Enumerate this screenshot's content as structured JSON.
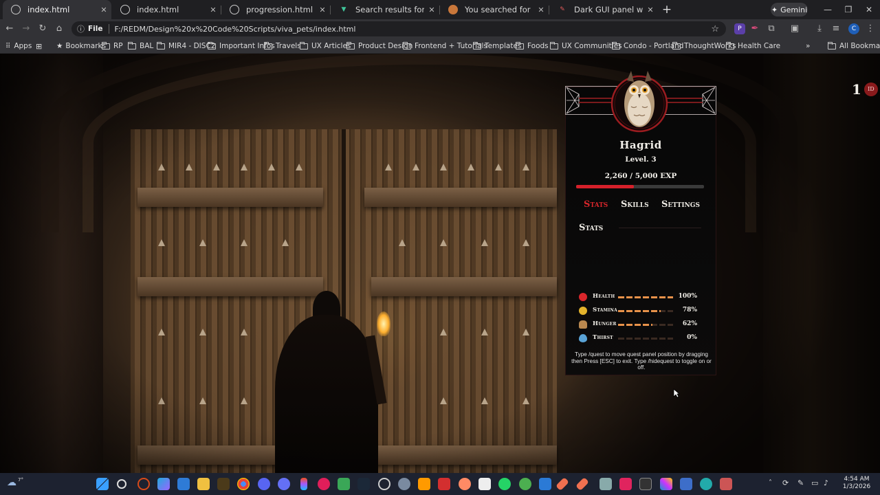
{
  "browser": {
    "tabs": [
      {
        "title": "index.html",
        "icon": "globe-icon",
        "active": true
      },
      {
        "title": "index.html",
        "icon": "globe-icon",
        "active": false
      },
      {
        "title": "progression.html",
        "icon": "globe-icon",
        "active": false
      },
      {
        "title": "Search results for Thirst - Flatic",
        "icon": "flaticon-icon",
        "active": false
      },
      {
        "title": "You searched for health - Craftf",
        "icon": "craftpix-icon",
        "active": false
      },
      {
        "title": "Dark GUI panel with red HEALTH",
        "icon": "pen-icon",
        "active": false
      }
    ],
    "new_tab": "+",
    "gemini_label": "Gemini",
    "address_prefix": "File",
    "url": "F:/REDM/Design%20x%20Code%20Scripts/viva_pets/index.html",
    "bookmarks": [
      "Apps",
      "Bookmarks",
      "RP",
      "BAL",
      "MIR4 - DISC2",
      "Important Infos",
      "Travels",
      "UX Articles",
      "Product Design",
      "Frontend + Tutorials",
      "Templates",
      "Foods",
      "UX Communities",
      "Condo - Portland",
      "ThoughtWorks",
      "Health Care"
    ],
    "all_bookmarks": "All Bookmarks"
  },
  "hud": {
    "id_number": "1",
    "id_badge": "ID"
  },
  "panel": {
    "name": "Hagrid",
    "level": "Level. 3",
    "exp_text": "2,260 / 5,000 EXP",
    "exp_fraction": 0.452,
    "tabs": [
      "Stats",
      "Skills",
      "Settings"
    ],
    "active_tab": "Stats",
    "stats_heading": "Stats",
    "stats": [
      {
        "label": "Health",
        "pct_text": "100%",
        "value": 1.0,
        "icon": "heart-icon",
        "icon_color": "#d9262b"
      },
      {
        "label": "Stamina",
        "pct_text": "78%",
        "value": 0.78,
        "icon": "stamina-icon",
        "icon_color": "#e3b32c"
      },
      {
        "label": "Hunger",
        "pct_text": "62%",
        "value": 0.62,
        "icon": "food-icon",
        "icon_color": "#b9884f"
      },
      {
        "label": "Thirst",
        "pct_text": "0%",
        "value": 0.0,
        "icon": "water-icon",
        "icon_color": "#5aa3d6"
      }
    ],
    "hint": "Type /quest to move quest panel position by dragging then Press [ESC] to exit. Type /hidequest to toggle on or off.",
    "accent_color": "#d9262b",
    "bar_color": "#e8924a"
  },
  "taskbar": {
    "weather_temp": "7°",
    "time": "4:54 AM",
    "date": "1/3/2026"
  }
}
